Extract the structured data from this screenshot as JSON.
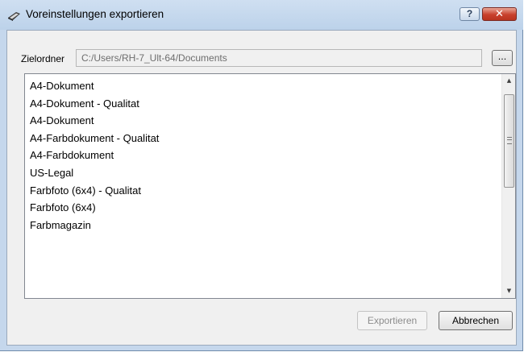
{
  "window": {
    "title": "Voreinstellungen exportieren",
    "help_label": "?",
    "close_label": "✕"
  },
  "folder": {
    "label": "Zielordner",
    "value": "C:/Users/RH-7_Ult-64/Documents",
    "browse_label": "..."
  },
  "presets": {
    "items": [
      "A4-Dokument",
      "A4-Dokument - Qualitat",
      "A4-Dokument",
      "A4-Farbdokument - Qualitat",
      "A4-Farbdokument",
      "US-Legal",
      "Farbfoto (6x4) - Qualitat",
      "Farbfoto (6x4)",
      "Farbmagazin"
    ]
  },
  "buttons": {
    "export_label": "Exportieren",
    "cancel_label": "Abbrechen"
  },
  "icons": {
    "app": "scanner-icon",
    "scroll_up": "chevron-up-icon",
    "scroll_down": "chevron-down-icon"
  }
}
